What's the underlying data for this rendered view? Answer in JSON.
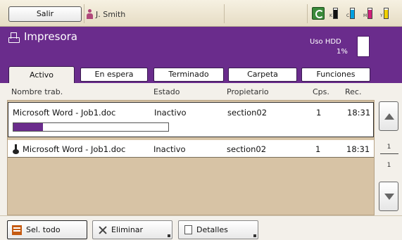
{
  "topbar": {
    "logout_label": "Salir",
    "user_name": "J. Smith",
    "toners": [
      {
        "label": "K",
        "color": "#111111",
        "level": 0.85
      },
      {
        "label": "C",
        "color": "#00a0e0",
        "level": 0.85
      },
      {
        "label": "M",
        "color": "#d0207a",
        "level": 0.85
      },
      {
        "label": "Y",
        "color": "#f0d000",
        "level": 0.85
      }
    ]
  },
  "header": {
    "title": "Impresora",
    "hdd_label": "Uso HDD",
    "hdd_value": "1%",
    "hdd_level": 0.01,
    "accent_color": "#6a2c8c"
  },
  "tabs": [
    {
      "label": "Activo",
      "active": true
    },
    {
      "label": "En espera",
      "active": false
    },
    {
      "label": "Terminado",
      "active": false
    },
    {
      "label": "Carpeta",
      "active": false
    },
    {
      "label": "Funciones",
      "active": false
    }
  ],
  "table": {
    "columns": [
      "Nombre trab.",
      "Estado",
      "Propietario",
      "Cps.",
      "Rec."
    ],
    "rows": [
      {
        "name": "Microsoft Word - Job1.doc",
        "status": "Inactivo",
        "owner": "section02",
        "copies": "1",
        "received": "18:31",
        "progress": 0.19,
        "icon": "none"
      },
      {
        "name": "Microsoft Word - Job1.doc",
        "status": "Inactivo",
        "owner": "section02",
        "copies": "1",
        "received": "18:31",
        "icon": "hold-icon"
      }
    ]
  },
  "pagination": {
    "current": "1",
    "total": "1"
  },
  "bottom": {
    "select_all": "Sel. todo",
    "delete": "Eliminar",
    "details": "Detalles"
  }
}
